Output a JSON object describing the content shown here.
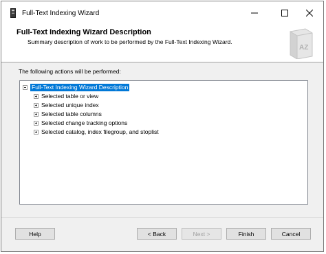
{
  "window": {
    "title": "Full-Text Indexing Wizard",
    "controls": {
      "minimize": "minimize-icon",
      "maximize": "maximize-icon",
      "close": "close-icon"
    }
  },
  "header": {
    "title": "Full-Text Indexing Wizard Description",
    "subtitle": "Summary description of work to be performed by the Full-Text Indexing Wizard."
  },
  "main": {
    "actions_label": "The following actions will be performed:",
    "tree": {
      "root": "Full-Text Indexing Wizard Description",
      "items": [
        "Selected table or view",
        "Selected unique index",
        "Selected table columns",
        "Selected change tracking options",
        "Selected catalog, index filegroup, and stoplist"
      ]
    }
  },
  "footer": {
    "help": "Help",
    "back": "< Back",
    "next": "Next >",
    "finish": "Finish",
    "cancel": "Cancel"
  },
  "colors": {
    "selection": "#0078d7",
    "window_bg": "#f0f0f0"
  }
}
